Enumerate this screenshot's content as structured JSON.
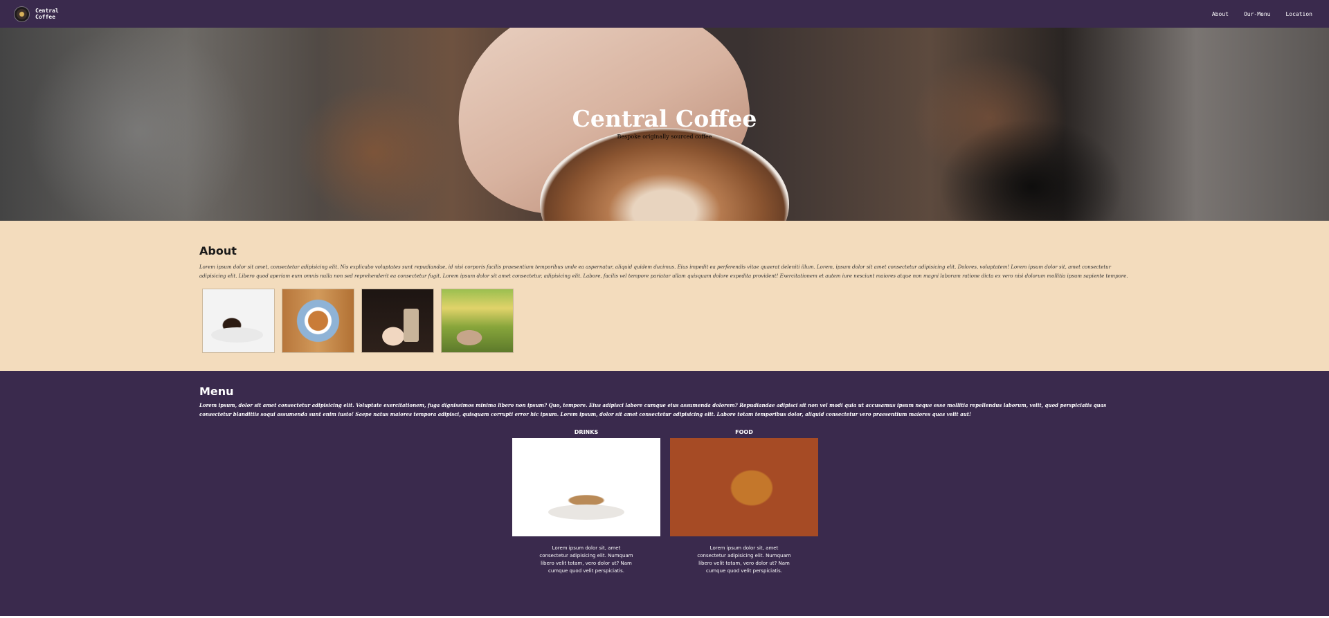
{
  "nav": {
    "brand": "Central Coffee",
    "links": [
      "About",
      "Our-Menu",
      "Location"
    ]
  },
  "hero": {
    "title": "Central Coffee",
    "subtitle": "Bespoke originally sourced coffee"
  },
  "about": {
    "title": "About",
    "text": "Lorem ipsum dolor sit amet, consectetur adipisicing elit. Nis explicabo voluptates sunt repudiandae, id nisi corporis facilis praesentium temporibus unde ea aspernatur, aliquid quidem ducimus. Eius impedit ea perferendis vitae quaerat deleniti illum. Lorem, ipsum dolor sit amet consectetur adipisicing elit. Dolores, voluptatem! Lorem ipsum dolor sit, amet consectetur adipisicing elit. Libero quod aperiam eum omnis nulla non sed reprehenderit ea consectetur fugit. Lorem ipsum dolor sit amet consectetur, adipisicing elit. Labore, facilis vel tempore pariatur ullam quisquam dolore expedita provident! Exercitationem et autem iure nesciunt maiores atque non magni laborum ratione dicta ex vero nisi dolorum mollitia ipsum sapiente tempore."
  },
  "menu": {
    "title": "Menu",
    "text": "Lorem ipsum, dolor sit amet consectetur adipisicing elit. Voluptate exercitationem, fuga dignissimos minima libero non ipsum? Quo, tempore. Eius adipisci labore cumque eius assumenda dolorem? Repudiandae adipisci sit non vel modi quia ut accusamus ipsum neque esse mollitia repellendus laborum, velit, quod perspiciatis quas consectetur blanditiis soqui assumenda sunt enim iusto! Saepe natus maiores tempora adipisci, quisquam corrupti error hic ipsum. Lorem ipsum, dolor sit amet consectetur adipisicing elit. Labore totam temporibus dolor, aliquid consectetur vero praesentium maiores quas velit aut!",
    "cards": [
      {
        "title": "DRINKS",
        "description": "Lorem ipsum dolor sit, amet consectetur adipisicing elit. Numquam libero velit totam, vero dolor ut? Nam cumque quod velit perspiciatis."
      },
      {
        "title": "FOOD",
        "description": "Lorem ipsum dolor sit, amet consectetur adipisicing elit. Numquam libero velit totam, vero dolor ut? Nam cumque quod velit perspiciatis."
      }
    ]
  },
  "colors": {
    "nav_bg": "#3a2a4d",
    "about_bg": "#f3dcbd",
    "menu_bg": "#3a2a4d"
  }
}
